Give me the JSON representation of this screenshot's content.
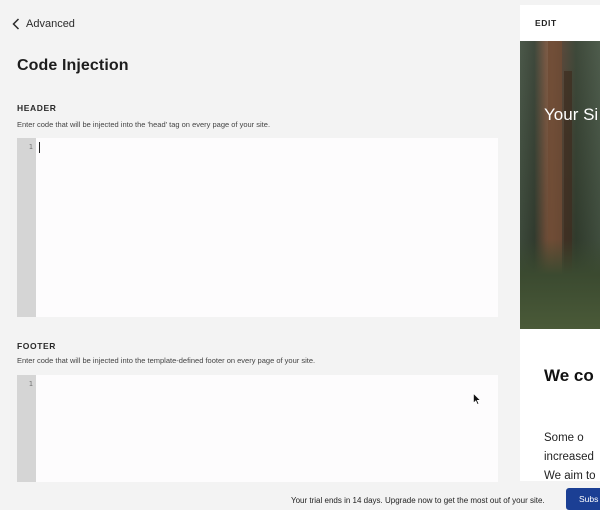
{
  "nav": {
    "back_label": "Advanced"
  },
  "page": {
    "title": "Code Injection"
  },
  "header_section": {
    "heading": "HEADER",
    "description": "Enter code that will be injected into the 'head' tag on every page of your site.",
    "line_number": "1",
    "value": ""
  },
  "footer_section": {
    "heading": "FOOTER",
    "description": "Enter code that will be injected into the template-defined footer on every page of your site.",
    "line_number": "1",
    "value": ""
  },
  "preview": {
    "edit_label": "EDIT",
    "hero_title": "Your Si",
    "heading": "We co",
    "body_lines": [
      "Some o",
      "increased",
      "We aim to"
    ]
  },
  "trial": {
    "message": "Your trial ends in 14 days. Upgrade now to get the most out of your site.",
    "button_label": "Subs"
  },
  "colors": {
    "accent": "#1b3f94",
    "gutter": "#d5d5d5",
    "background": "#f3f3f3"
  }
}
